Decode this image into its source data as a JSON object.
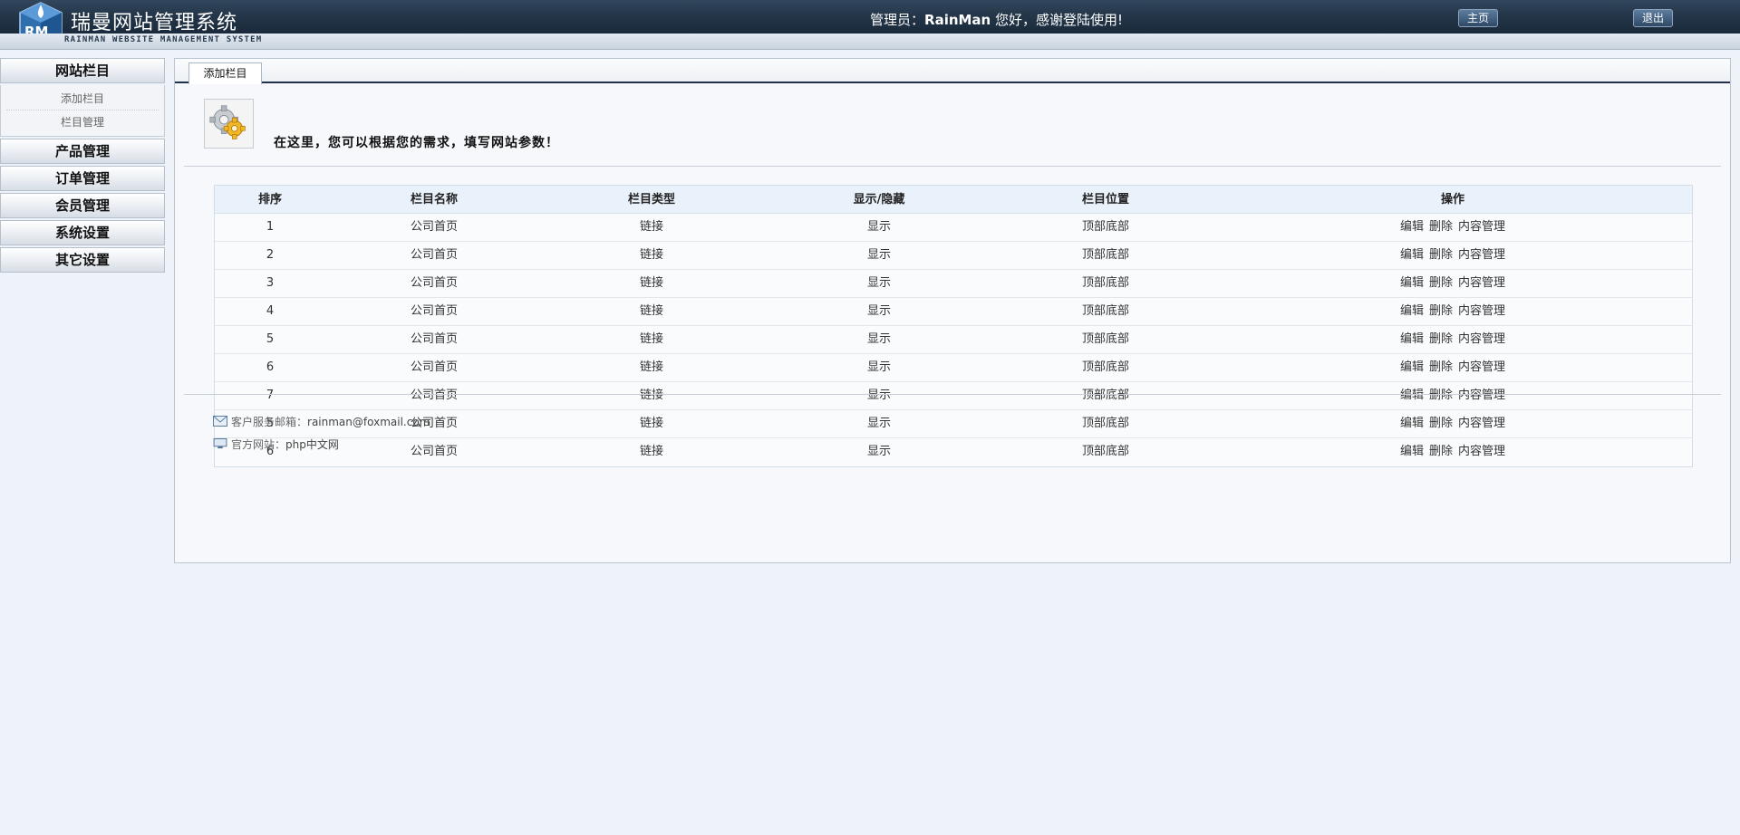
{
  "header": {
    "logo_letters": "RM",
    "title": "瑞曼网站管理系统",
    "subtitle": "RAINMAN WEBSITE MANAGEMENT SYSTEM",
    "welcome_prefix": "管理员：",
    "username": "RainMan",
    "welcome_suffix": " 您好，感谢登陆使用!",
    "home_button": "主页",
    "logout_button": "退出"
  },
  "sidebar": {
    "sections": [
      {
        "label": "网站栏目",
        "items": [
          "添加栏目",
          "栏目管理"
        ]
      },
      {
        "label": "产品管理"
      },
      {
        "label": "订单管理"
      },
      {
        "label": "会员管理"
      },
      {
        "label": "系统设置"
      },
      {
        "label": "其它设置"
      }
    ]
  },
  "main": {
    "tab": "添加栏目",
    "intro": "在这里，您可以根据您的需求，填写网站参数！",
    "table": {
      "headers": [
        "排序",
        "栏目名称",
        "栏目类型",
        "显示/隐藏",
        "栏目位置",
        "操作"
      ],
      "rows": [
        [
          "1",
          "公司首页",
          "链接",
          "显示",
          "顶部底部"
        ],
        [
          "2",
          "公司首页",
          "链接",
          "显示",
          "顶部底部"
        ],
        [
          "3",
          "公司首页",
          "链接",
          "显示",
          "顶部底部"
        ],
        [
          "4",
          "公司首页",
          "链接",
          "显示",
          "顶部底部"
        ],
        [
          "5",
          "公司首页",
          "链接",
          "显示",
          "顶部底部"
        ],
        [
          "6",
          "公司首页",
          "链接",
          "显示",
          "顶部底部"
        ],
        [
          "7",
          "公司首页",
          "链接",
          "显示",
          "顶部底部"
        ],
        [
          "5",
          "公司首页",
          "链接",
          "显示",
          "顶部底部"
        ],
        [
          "6",
          "公司首页",
          "链接",
          "显示",
          "顶部底部"
        ]
      ],
      "actions": [
        "编辑",
        "删除",
        "内容管理"
      ]
    },
    "footer": {
      "email_label": "客户服务邮箱：",
      "email": "rainman@foxmail.com",
      "site_label": "官方网站：",
      "site": "php中文网"
    }
  },
  "icons": {
    "logo": "cube-logo-icon",
    "settings": "gear-icon",
    "email": "envelope-icon",
    "website": "monitor-icon"
  },
  "colors": {
    "header_bg": "#243649",
    "page_bg": "#eef2f9",
    "table_head_bg": "#e9f1fa"
  }
}
